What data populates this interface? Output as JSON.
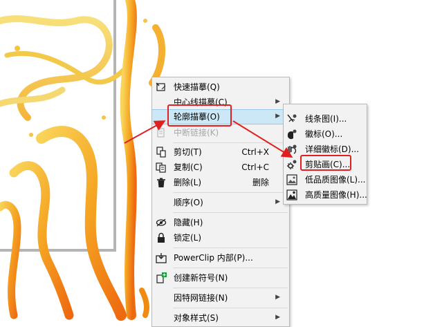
{
  "context_menu": {
    "items": [
      {
        "icon": "quick-trace-icon",
        "label": "快速描摹(Q)"
      },
      {
        "icon": "",
        "label": "中心线描摹(C)"
      },
      {
        "icon": "",
        "label": "轮廓描摹(O)"
      },
      {
        "icon": "break-link-icon",
        "label": "中断链接(K)"
      },
      {
        "icon": "cut-icon",
        "label": "剪切(T)",
        "shortcut": "Ctrl+X"
      },
      {
        "icon": "copy-icon",
        "label": "复制(C)",
        "shortcut": "Ctrl+C"
      },
      {
        "icon": "trash-icon",
        "label": "删除(L)",
        "shortcut": "删除"
      },
      {
        "icon": "",
        "label": "顺序(O)"
      },
      {
        "icon": "eye-hide-icon",
        "label": "隐藏(H)"
      },
      {
        "icon": "lock-icon",
        "label": "锁定(L)"
      },
      {
        "icon": "powerclip-icon",
        "label": "PowerClip 内部(P)..."
      },
      {
        "icon": "new-symbol-icon",
        "label": "创建新符号(N)"
      },
      {
        "icon": "",
        "label": "因特网链接(N)"
      },
      {
        "icon": "",
        "label": "对象样式(S)"
      }
    ]
  },
  "submenu": {
    "items": [
      {
        "icon": "line-art-icon",
        "label": "线条图(I)..."
      },
      {
        "icon": "logo-icon",
        "label": "徽标(O)..."
      },
      {
        "icon": "detailed-logo-icon",
        "label": "详细徽标(D)..."
      },
      {
        "icon": "clipart-icon",
        "label": "剪贴画(C)..."
      },
      {
        "icon": "low-quality-image-icon",
        "label": "低品质图像(L)..."
      },
      {
        "icon": "high-quality-image-icon",
        "label": "高质量图像(H)..."
      }
    ]
  },
  "colors": {
    "highlight": "#cce8f6",
    "annotation_red": "#e02020",
    "menu_bg": "#f2f2f2",
    "artwork_orange": "#f08a10",
    "artwork_yellow": "#f4c63c"
  }
}
